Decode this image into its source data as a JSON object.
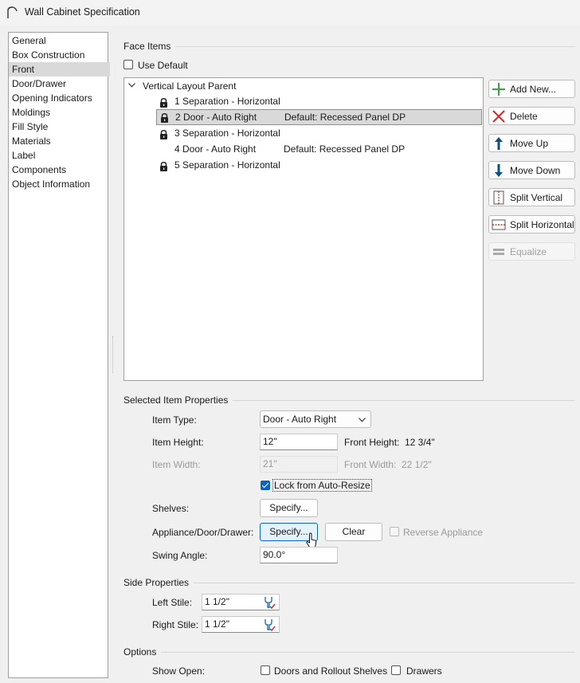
{
  "window": {
    "title": "Wall Cabinet Specification"
  },
  "categories": [
    {
      "label": "General",
      "selected": false
    },
    {
      "label": "Box Construction",
      "selected": false
    },
    {
      "label": "Front",
      "selected": true
    },
    {
      "label": "Door/Drawer",
      "selected": false
    },
    {
      "label": "Opening Indicators",
      "selected": false
    },
    {
      "label": "Moldings",
      "selected": false
    },
    {
      "label": "Fill Style",
      "selected": false
    },
    {
      "label": "Materials",
      "selected": false
    },
    {
      "label": "Label",
      "selected": false
    },
    {
      "label": "Components",
      "selected": false
    },
    {
      "label": "Object Information",
      "selected": false
    }
  ],
  "face_items": {
    "group_label": "Face Items",
    "use_default": {
      "label": "Use Default",
      "checked": false
    },
    "tree": {
      "parent_label": "Vertical Layout Parent",
      "items": [
        {
          "label": "1 Separation - Horizontal",
          "detail": "",
          "locked": true,
          "selected": false
        },
        {
          "label": "2 Door - Auto Right",
          "detail": "Default: Recessed Panel DP",
          "locked": true,
          "selected": true
        },
        {
          "label": "3 Separation - Horizontal",
          "detail": "",
          "locked": true,
          "selected": false
        },
        {
          "label": "4 Door - Auto Right",
          "detail": "Default: Recessed Panel DP",
          "locked": false,
          "selected": false
        },
        {
          "label": "5 Separation - Horizontal",
          "detail": "",
          "locked": true,
          "selected": false
        }
      ]
    },
    "buttons": [
      {
        "label": "Add New...",
        "icon": "plus-icon",
        "enabled": true
      },
      {
        "label": "Delete",
        "icon": "x-icon",
        "enabled": true
      },
      {
        "label": "Move Up",
        "icon": "arrow-up-icon",
        "enabled": true
      },
      {
        "label": "Move Down",
        "icon": "arrow-down-icon",
        "enabled": true
      },
      {
        "label": "Split Vertical",
        "icon": "split-vertical-icon",
        "enabled": true
      },
      {
        "label": "Split Horizontal",
        "icon": "split-horizontal-icon",
        "enabled": true
      },
      {
        "label": "Equalize",
        "icon": "equalize-icon",
        "enabled": false
      }
    ]
  },
  "selected_item": {
    "group_label": "Selected Item Properties",
    "item_type_label": "Item Type:",
    "item_type_value": "Door - Auto Right",
    "item_height_label": "Item Height:",
    "item_height_value": "12\"",
    "front_height_label": "Front Height:",
    "front_height_value": "12 3/4\"",
    "item_width_label": "Item Width:",
    "item_width_value": "21\"",
    "front_width_label": "Front Width:",
    "front_width_value": "22 1/2\"",
    "lock_label": "Lock from Auto-Resize",
    "lock_checked": true,
    "shelves_label": "Shelves:",
    "shelves_button": "Specify...",
    "appliance_label": "Appliance/Door/Drawer:",
    "appliance_button": "Specify...",
    "clear_button": "Clear",
    "reverse_label": "Reverse Appliance",
    "reverse_checked": false,
    "swing_label": "Swing Angle:",
    "swing_value": "90.0°"
  },
  "side_properties": {
    "group_label": "Side Properties",
    "left_stile_label": "Left Stile:",
    "left_stile_value": "1 1/2\"",
    "right_stile_label": "Right Stile:",
    "right_stile_value": "1 1/2\""
  },
  "options": {
    "group_label": "Options",
    "show_open_label": "Show Open:",
    "doors_label": "Doors and Rollout Shelves",
    "doors_checked": false,
    "drawers_label": "Drawers",
    "drawers_checked": false
  },
  "colors": {
    "accent": "#0a64c2",
    "add": "#3aa53a",
    "delete": "#d12b2b",
    "arrow": "#0b4f8a",
    "split": "#c0392b"
  }
}
